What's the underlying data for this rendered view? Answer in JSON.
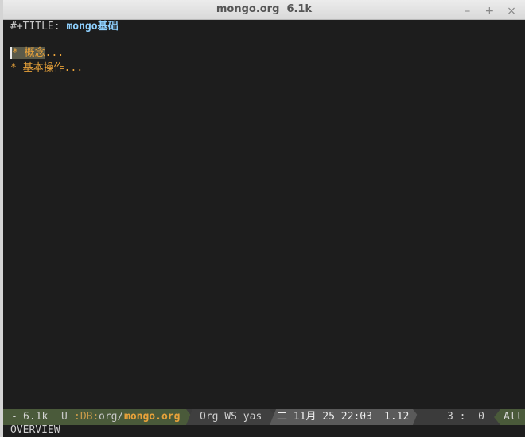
{
  "window": {
    "title": "mongo.org  6.1k",
    "buttons": {
      "minimize": "–",
      "maximize": "+",
      "close": "×"
    }
  },
  "buffer": {
    "title_keyword": "#+TITLE:",
    "title_value": "mongo基础",
    "headings": [
      {
        "star": "*",
        "text": "概念",
        "ellipsis": "..."
      },
      {
        "star": "*",
        "text": "基本操作",
        "ellipsis": "..."
      }
    ]
  },
  "modeline": {
    "state": "-",
    "size": "6.1k",
    "encoding": "U",
    "path_prefix": ":DB:",
    "path_dir": "org/",
    "filename": "mongo.org",
    "modes": "Org WS yas",
    "datetime": "二 11月 25 22:03",
    "load": "1.12",
    "position": "3 :  0",
    "scroll": "All",
    "colors": {
      "bg": "#3b3b3b",
      "accent_green": "#4a5a3a",
      "accent_gray": "#5a5a5a",
      "filename": "#e8a23a"
    }
  },
  "echo_area": "OVERVIEW"
}
